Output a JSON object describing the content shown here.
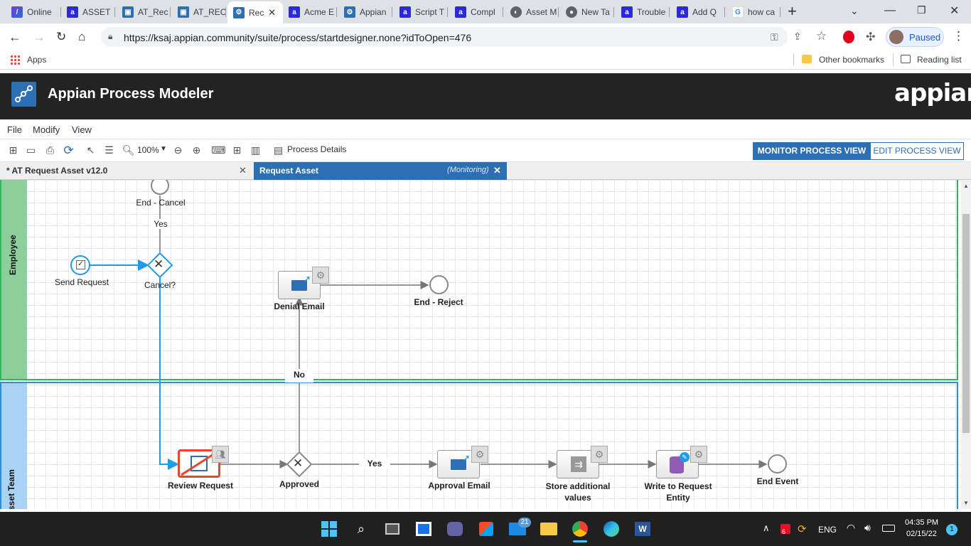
{
  "browser": {
    "tabs": [
      {
        "label": "Online",
        "icon": "online-icon"
      },
      {
        "label": "ASSET",
        "icon": "appian-a-icon"
      },
      {
        "label": "AT_Rec",
        "icon": "appian-record-icon"
      },
      {
        "label": "AT_REC",
        "icon": "appian-record-icon"
      },
      {
        "label": "Rec",
        "icon": "appian-process-icon",
        "active": true
      },
      {
        "label": "Acme E",
        "icon": "appian-a-icon"
      },
      {
        "label": "Appian",
        "icon": "appian-process-icon"
      },
      {
        "label": "Script T",
        "icon": "appian-a-icon"
      },
      {
        "label": "Compl",
        "icon": "appian-a-icon"
      },
      {
        "label": "Asset M",
        "icon": "globe-icon"
      },
      {
        "label": "New Ta",
        "icon": "chrome-icon"
      },
      {
        "label": "Trouble",
        "icon": "appian-a-icon"
      },
      {
        "label": "Add Q",
        "icon": "appian-a-icon"
      },
      {
        "label": "how ca",
        "icon": "google-icon"
      }
    ],
    "url": "https://ksaj.appian.community/suite/process/startdesigner.none?idToOpen=476",
    "profile_label": "Paused",
    "bookmarks": {
      "apps": "Apps",
      "other": "Other bookmarks",
      "reading": "Reading list"
    }
  },
  "app": {
    "title": "Appian Process Modeler",
    "brand": "appian"
  },
  "menu": {
    "file": "File",
    "modify": "Modify",
    "view": "View"
  },
  "toolbar": {
    "zoom": "100%",
    "process_details": "Process Details",
    "monitor_view": "MONITOR PROCESS VIEW",
    "edit_view": "EDIT PROCESS VIEW"
  },
  "doc_tabs": {
    "tab1": "* AT Request Asset v12.0",
    "tab2": "Request Asset",
    "tab2_status": "(Monitoring)"
  },
  "lanes": {
    "top": "Employee",
    "bottom": "sset Team"
  },
  "nodes": {
    "end_cancel": "End - Cancel",
    "yes_top": "Yes",
    "send_request": "Send Request",
    "cancel_gw": "Cancel?",
    "denial_email": "Denial Email",
    "end_reject": "End - Reject",
    "no": "No",
    "review_request": "Review Request",
    "approved": "Approved",
    "yes_bottom": "Yes",
    "approval_email": "Approval Email",
    "store_values_1": "Store additional",
    "store_values_2": "values",
    "write_entity_1": "Write to Request",
    "write_entity_2": "Entity",
    "end_event": "End Event"
  },
  "taskbar": {
    "mail_badge": "21",
    "lang": "ENG",
    "time": "04:35 PM",
    "date": "02/15/22",
    "notif_count": "1",
    "tray_badge": "6"
  },
  "colors": {
    "app_header": "#232323",
    "appian_blue": "#2c6fb2",
    "lane_employee": "#8dce9c",
    "lane_asset": "#a9d2f5",
    "flow_active": "#1e9be9",
    "flow_default": "#777777"
  }
}
